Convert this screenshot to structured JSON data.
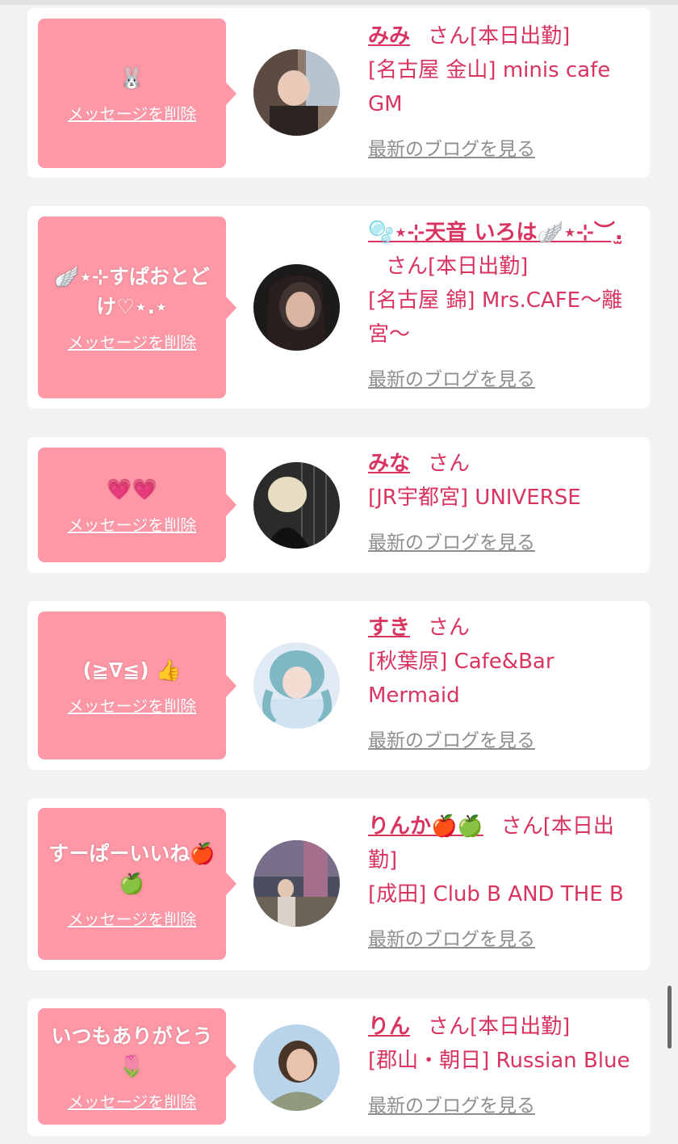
{
  "cards": [
    {
      "message": "🐰",
      "delete_label": "メッセージを削除",
      "name": "みみ",
      "honorific": "さん",
      "tag": "[本日出勤]",
      "shop": "[名古屋 金山] minis cafe GM",
      "blog_label": "最新のブログを見る"
    },
    {
      "message": "🪽⋆⊹すぱおとどけ♡⋆.⋆",
      "delete_label": "メッセージを削除",
      "name": "🫧⋆⊹天音 いろは🪽⋆⊹︶.̫",
      "honorific": "さん",
      "tag": "[本日出勤]",
      "shop": "[名古屋 錦] Mrs.CAFE〜離宮〜",
      "blog_label": "最新のブログを見る"
    },
    {
      "message": "💗💗",
      "delete_label": "メッセージを削除",
      "name": "みな",
      "honorific": "さん",
      "tag": "",
      "shop": "[JR宇都宮] UNIVERSE",
      "blog_label": "最新のブログを見る"
    },
    {
      "message": "(≧∇≦) 👍",
      "delete_label": "メッセージを削除",
      "name": "すき",
      "honorific": "さん",
      "tag": "",
      "shop": "[秋葉原] Cafe&Bar Mermaid",
      "blog_label": "最新のブログを見る"
    },
    {
      "message": "すーぱーいいね🍎🍏",
      "delete_label": "メッセージを削除",
      "name": "りんか🍎🍏",
      "honorific": "さん",
      "tag": "[本日出勤]",
      "shop": "[成田] Club B AND THE B",
      "blog_label": "最新のブログを見る"
    },
    {
      "message": "いつもありがとう🌷",
      "delete_label": "メッセージを削除",
      "name": "りん",
      "honorific": "さん",
      "tag": "[本日出勤]",
      "shop": "[郡山・朝日] Russian Blue",
      "blog_label": "最新のブログを見る"
    }
  ]
}
